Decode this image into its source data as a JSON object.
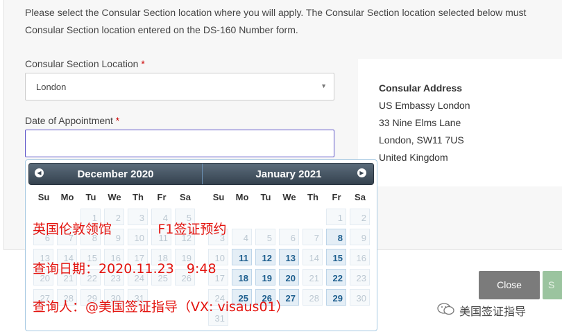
{
  "intro": {
    "line1": "Please select the Consular Section location where you will apply. The Consular Section location selected below must",
    "line2": "Consular Section location entered on the DS-160 Number form."
  },
  "location": {
    "label": "Consular Section Location",
    "required_mark": "*",
    "value": "London"
  },
  "date": {
    "label": "Date of Appointment",
    "required_mark": "*",
    "value": ""
  },
  "address": {
    "title": "Consular Address",
    "lines": [
      "US Embassy London",
      "33 Nine Elms Lane",
      "London, SW11 7US",
      "United Kingdom"
    ]
  },
  "datepicker": {
    "weekdays": [
      "Su",
      "Mo",
      "Tu",
      "We",
      "Th",
      "Fr",
      "Sa"
    ],
    "months": [
      {
        "title": "December 2020",
        "weeks": [
          [
            null,
            null,
            {
              "d": "1",
              "s": "dis"
            },
            {
              "d": "2",
              "s": "dis"
            },
            {
              "d": "3",
              "s": "dis"
            },
            {
              "d": "4",
              "s": "dis"
            },
            {
              "d": "5",
              "s": "dis"
            }
          ],
          [
            {
              "d": "6",
              "s": "dis"
            },
            {
              "d": "7",
              "s": "dis"
            },
            {
              "d": "8",
              "s": "dis"
            },
            {
              "d": "9",
              "s": "dis"
            },
            {
              "d": "10",
              "s": "dis"
            },
            {
              "d": "11",
              "s": "dis"
            },
            {
              "d": "12",
              "s": "dis"
            }
          ],
          [
            {
              "d": "13",
              "s": "dis"
            },
            {
              "d": "14",
              "s": "dis"
            },
            {
              "d": "15",
              "s": "dis"
            },
            {
              "d": "16",
              "s": "dis"
            },
            {
              "d": "17",
              "s": "dis"
            },
            {
              "d": "18",
              "s": "dis"
            },
            {
              "d": "19",
              "s": "dis"
            }
          ],
          [
            {
              "d": "20",
              "s": "dis"
            },
            {
              "d": "21",
              "s": "dis"
            },
            {
              "d": "22",
              "s": "dis"
            },
            {
              "d": "23",
              "s": "dis"
            },
            {
              "d": "24",
              "s": "dis"
            },
            {
              "d": "25",
              "s": "dis"
            },
            {
              "d": "26",
              "s": "dis"
            }
          ],
          [
            {
              "d": "27",
              "s": "dis"
            },
            {
              "d": "28",
              "s": "dis"
            },
            {
              "d": "29",
              "s": "dis"
            },
            {
              "d": "30",
              "s": "dis"
            },
            {
              "d": "31",
              "s": "dis"
            },
            null,
            null
          ]
        ]
      },
      {
        "title": "January 2021",
        "weeks": [
          [
            null,
            null,
            null,
            null,
            null,
            {
              "d": "1",
              "s": "dis"
            },
            {
              "d": "2",
              "s": "dis"
            }
          ],
          [
            {
              "d": "3",
              "s": "dis"
            },
            {
              "d": "4",
              "s": "dis"
            },
            {
              "d": "5",
              "s": "dis"
            },
            {
              "d": "6",
              "s": "dis"
            },
            {
              "d": "7",
              "s": "dis"
            },
            {
              "d": "8",
              "s": "en"
            },
            {
              "d": "9",
              "s": "dis"
            }
          ],
          [
            {
              "d": "10",
              "s": "dis"
            },
            {
              "d": "11",
              "s": "en"
            },
            {
              "d": "12",
              "s": "en"
            },
            {
              "d": "13",
              "s": "en"
            },
            {
              "d": "14",
              "s": "dis"
            },
            {
              "d": "15",
              "s": "en"
            },
            {
              "d": "16",
              "s": "dis"
            }
          ],
          [
            {
              "d": "17",
              "s": "dis"
            },
            {
              "d": "18",
              "s": "en"
            },
            {
              "d": "19",
              "s": "en"
            },
            {
              "d": "20",
              "s": "en"
            },
            {
              "d": "21",
              "s": "dis"
            },
            {
              "d": "22",
              "s": "en"
            },
            {
              "d": "23",
              "s": "dis"
            }
          ],
          [
            {
              "d": "24",
              "s": "dis"
            },
            {
              "d": "25",
              "s": "en"
            },
            {
              "d": "26",
              "s": "en"
            },
            {
              "d": "27",
              "s": "en"
            },
            {
              "d": "28",
              "s": "dis"
            },
            {
              "d": "29",
              "s": "en"
            },
            {
              "d": "30",
              "s": "dis"
            }
          ],
          [
            {
              "d": "31",
              "s": "dis"
            },
            null,
            null,
            null,
            null,
            null,
            null
          ]
        ]
      }
    ],
    "prev_icon": "◀",
    "next_icon": "▶"
  },
  "buttons": {
    "close": "Close",
    "next": "S"
  },
  "overlay": {
    "line1": "英国伦敦领馆           F1签证预约",
    "line2": "查询日期：2020.11.23   9:48",
    "line3": "查询人：@美国签证指导（VX: visaus01）"
  },
  "watermark": {
    "text": "美国签证指导",
    "icon": "wechat-icon"
  },
  "colors": {
    "required": "#cc0000",
    "overlay_text": "#e3140f",
    "header_dark": "#35424f",
    "available_day": "#1d5e8e"
  }
}
